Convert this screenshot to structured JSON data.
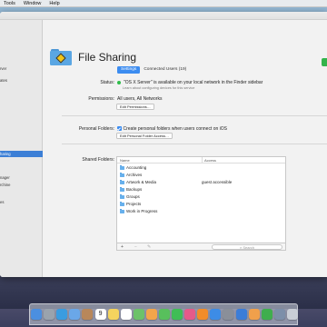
{
  "menubar": {
    "items": [
      "Tools",
      "Window",
      "Help"
    ]
  },
  "sidebar": {
    "items": [
      "rver",
      "ates",
      "haring",
      "nager",
      "rchine",
      "es"
    ],
    "selected_index": 2
  },
  "header": {
    "title": "File Sharing"
  },
  "tabs": [
    {
      "label": "Settings",
      "active": true
    },
    {
      "label": "Connected Users (19)",
      "active": false
    }
  ],
  "status": {
    "label": "Status:",
    "text": "\"OS X Server\" is available on your local network in the Finder sidebar",
    "link": "Learn about configuring devices for this service"
  },
  "permissions": {
    "label": "Permissions:",
    "value": "All users, All Networks",
    "button": "Edit Permissions…"
  },
  "personal_folders": {
    "label": "Personal Folders:",
    "checkbox_label": "Create personal folders when users connect on iOS",
    "checked": true,
    "button": "Edit Personal Folder Access…"
  },
  "shared_folders": {
    "label": "Shared Folders:",
    "columns": [
      "Name",
      "Access"
    ],
    "rows": [
      {
        "name": "Accounting",
        "access": ""
      },
      {
        "name": "Archives",
        "access": ""
      },
      {
        "name": "Artwork & Media",
        "access": "guest accessible"
      },
      {
        "name": "Backups",
        "access": ""
      },
      {
        "name": "Groups",
        "access": ""
      },
      {
        "name": "Projects",
        "access": ""
      },
      {
        "name": "Work in Progress",
        "access": ""
      }
    ],
    "controls": {
      "add": "+",
      "remove": "−",
      "edit": "✎"
    },
    "search_placeholder": "Search"
  },
  "dock": {
    "calendar_day": "9",
    "icons": [
      "finder-icon",
      "launchpad-icon",
      "safari-icon",
      "mail-icon",
      "contacts-icon",
      "calendar-icon",
      "notes-icon",
      "reminders-icon",
      "maps-icon",
      "photos-icon",
      "messages-icon",
      "facetime-icon",
      "itunes-icon",
      "ibooks-icon",
      "appstore-icon",
      "system-preferences-icon",
      "keynote-icon",
      "pages-icon",
      "numbers-icon",
      "server-icon",
      "trash-icon"
    ],
    "colors": [
      "#4b8fe0",
      "#9aa3ad",
      "#3a9ce0",
      "#6aa7e8",
      "#b8875a",
      "#ffffff",
      "#f4d35e",
      "#ffffff",
      "#6cc26a",
      "#f3a54b",
      "#58c05c",
      "#3fbd56",
      "#e55a8a",
      "#f28c28",
      "#3d8ce6",
      "#8a8f99",
      "#3b7dd8",
      "#f0a04b",
      "#3fae4e",
      "#7d8fa9",
      "#c9ced6"
    ]
  }
}
